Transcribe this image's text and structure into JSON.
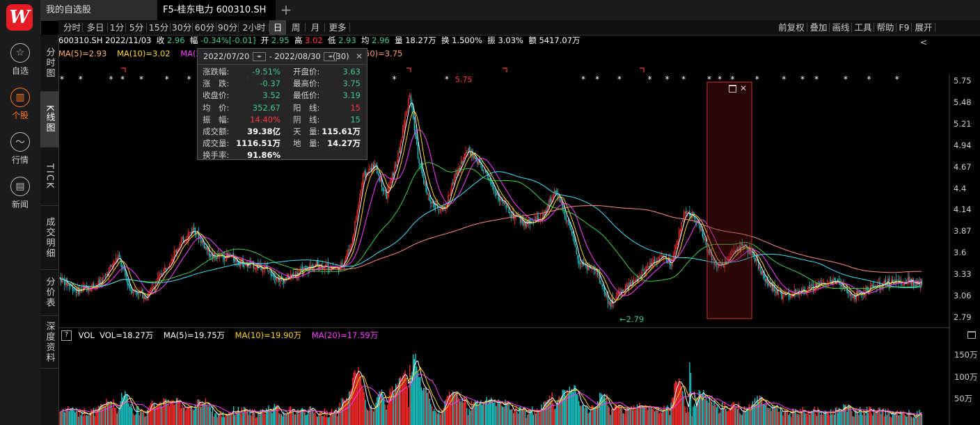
{
  "app": {
    "logo_text": "W"
  },
  "rail": [
    {
      "name": "watchlist",
      "label": "自选",
      "icon": "star-icon",
      "glyph": "☆"
    },
    {
      "name": "stock",
      "label": "个股",
      "icon": "stock-icon",
      "glyph": "▥",
      "active": true
    },
    {
      "name": "market",
      "label": "行情",
      "icon": "trend-icon",
      "glyph": "〜"
    },
    {
      "name": "news",
      "label": "新闻",
      "icon": "news-icon",
      "glyph": "▤"
    }
  ],
  "tabs": [
    {
      "label": "我的自选股"
    },
    {
      "label": "F5-桂东电力 600310.SH"
    }
  ],
  "add_tab_glyph": "+",
  "vtabs": [
    "分时图",
    "K线图",
    "TICK",
    "成交明细",
    "分价表",
    "深度资料"
  ],
  "periods": [
    "分时",
    "多日",
    "1分",
    "5分",
    "15分",
    "30分",
    "60分",
    "90分",
    "2小时",
    "日",
    "周",
    "月",
    "更多"
  ],
  "active_period": "日",
  "right_tools": [
    "前复权",
    "叠加",
    "画线",
    "工具",
    "帮助",
    "F9",
    "展开<"
  ],
  "info": {
    "code": "600310.SH",
    "date": "2022/11/03",
    "close_label": "收",
    "close": "2.96",
    "change_label": "幅",
    "change": "-0.34%[-0.01]",
    "open_label": "开",
    "open": "2.95",
    "high_label": "高",
    "high": "3.02",
    "low_label": "低",
    "low": "2.93",
    "avg_label": "均",
    "avg": "2.96",
    "vol_label": "量",
    "vol": "18.27万",
    "turnover_label": "换",
    "turnover": "1.500%",
    "amp_label": "振",
    "amp": "3.03%",
    "amount_label": "额",
    "amount": "5417.07万"
  },
  "ma_legend": {
    "ma5": "MA(5)=2.93",
    "ma10": "MA(10)=3.02",
    "ma20": "MA(20)",
    "ma250": "50)=3.75"
  },
  "colors": {
    "ma5": "#ffffff",
    "ma10": "#ffd21e",
    "ma20": "#ff3cff",
    "ma60": "#3fd23f",
    "ma120": "#3fe3ff",
    "ma250": "#ff8c7a",
    "up": "#ff2a2a",
    "down": "#19c7c7"
  },
  "price_axis": [
    "5.75",
    "5.48",
    "5.21",
    "4.94",
    "4.67",
    "4.4",
    "4.14",
    "3.87",
    "3.6",
    "3.33",
    "3.06",
    "2.79"
  ],
  "low_marker": "←2.79",
  "high_marker": "5.75",
  "vol_legend": {
    "help": "?",
    "name": "VOL",
    "vol": "VOL=18.27万",
    "ma5": "MA(5)=19.75万",
    "ma10": "MA(10)=19.90万",
    "ma20": "MA(20)=17.59万"
  },
  "vol_axis": [
    "150万",
    "100万",
    "50万"
  ],
  "popup": {
    "start": "2022/07/20",
    "end": "2022/08/30",
    "sep": "-",
    "count": "(30)",
    "close": "✕",
    "left": [
      {
        "label": "涨跌幅:",
        "value": "-9.51%",
        "color": "#3fc888"
      },
      {
        "label": "涨　跌:",
        "value": "-0.37",
        "color": "#3fc888"
      },
      {
        "label": "收盘价:",
        "value": "3.52",
        "color": "#3fc888"
      },
      {
        "label": "均　价:",
        "value": "352.67",
        "color": "#3fc888"
      },
      {
        "label": "振　幅:",
        "value": "14.40%",
        "color": "#ff3b3b"
      },
      {
        "label": "成交额:",
        "value": "39.38亿",
        "color": "#ffffff"
      },
      {
        "label": "成交量:",
        "value": "1116.51万",
        "color": "#ffffff"
      },
      {
        "label": "换手率:",
        "value": "91.86%",
        "color": "#ffffff"
      }
    ],
    "right": [
      {
        "label": "开盘价:",
        "value": "3.63",
        "color": "#3fc888"
      },
      {
        "label": "最高价:",
        "value": "3.75",
        "color": "#3fc888"
      },
      {
        "label": "最低价:",
        "value": "3.19",
        "color": "#3fc888"
      },
      {
        "label": "阳　线:",
        "value": "15",
        "color": "#ff3b3b"
      },
      {
        "label": "阴　线:",
        "value": "15",
        "color": "#3fc888"
      },
      {
        "label": "天　量:",
        "value": "115.61万",
        "color": "#ffffff"
      },
      {
        "label": "地　量:",
        "value": "14.27万",
        "color": "#ffffff"
      }
    ]
  }
}
